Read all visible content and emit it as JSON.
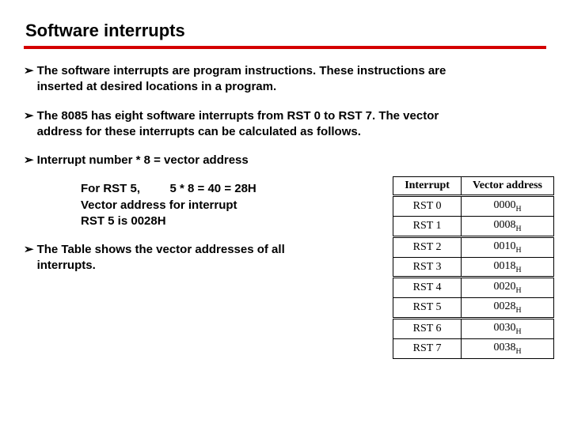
{
  "title": "Software interrupts",
  "bullets": {
    "b1": "The software interrupts are program instructions. These instructions are inserted at desired locations in a program.",
    "b2": "The 8085 has eight software interrupts from RST 0 to RST 7. The vector address for these interrupts can be calculated as follows.",
    "b3": "Interrupt number * 8 = vector address",
    "b4": "The Table shows the vector addresses of all interrupts."
  },
  "example": {
    "line1": "For RST 5,         5 *  8 = 40 = 28H",
    "line2": "Vector address for interrupt",
    "line3": "RST 5 is 0028H"
  },
  "table": {
    "headers": {
      "c1": "Interrupt",
      "c2": "Vector address"
    },
    "rows": [
      {
        "name": "RST 0",
        "addr": "0000",
        "sub": "H"
      },
      {
        "name": "RST 1",
        "addr": "0008",
        "sub": "H"
      },
      {
        "name": "RST 2",
        "addr": "0010",
        "sub": "H"
      },
      {
        "name": "RST 3",
        "addr": "0018",
        "sub": "H"
      },
      {
        "name": "RST 4",
        "addr": "0020",
        "sub": "H"
      },
      {
        "name": "RST 5",
        "addr": "0028",
        "sub": "H"
      },
      {
        "name": "RST 6",
        "addr": "0030",
        "sub": "H"
      },
      {
        "name": "RST 7",
        "addr": "0038",
        "sub": "H"
      }
    ]
  },
  "glyphs": {
    "bullet_arrow": "➢"
  }
}
